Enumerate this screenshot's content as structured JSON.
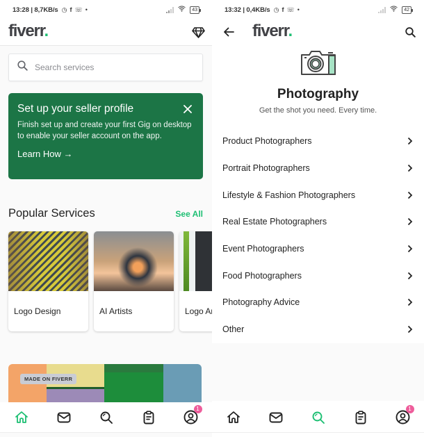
{
  "left_screen": {
    "status_bar": {
      "time_speed": "13:28 | 8,7KB/s",
      "battery": "43"
    },
    "header": {
      "logo_text": "fiverr",
      "logo_dot": ".",
      "right_icon": "diamond-icon"
    },
    "search": {
      "placeholder": "Search services"
    },
    "promo_card": {
      "title": "Set up your seller profile",
      "body": "Finish set up and create your first Gig on desktop to enable your seller account on the app.",
      "link": "Learn How →"
    },
    "popular_services": {
      "title": "Popular Services",
      "see_all": "See All",
      "items": [
        {
          "label": "Logo Design"
        },
        {
          "label": "AI Artists"
        },
        {
          "label": "Logo Animation"
        }
      ]
    },
    "banner": {
      "tag": "MADE ON FIVERR"
    },
    "tabbar": {
      "active": "home",
      "badge_count": "1"
    }
  },
  "right_screen": {
    "status_bar": {
      "time_speed": "13:32 | 0,4KB/s",
      "battery": "42"
    },
    "header": {
      "logo_text": "fiverr",
      "logo_dot": "."
    },
    "category": {
      "icon": "camera-icon",
      "title": "Photography",
      "subtitle": "Get the shot you need. Every time.",
      "subcategories": [
        {
          "label": "Product Photographers"
        },
        {
          "label": "Portrait Photographers"
        },
        {
          "label": "Lifestyle & Fashion Photographers"
        },
        {
          "label": "Real Estate Photographers"
        },
        {
          "label": "Event Photographers"
        },
        {
          "label": "Food Photographers"
        },
        {
          "label": "Photography Advice"
        },
        {
          "label": "Other"
        }
      ]
    },
    "tabbar": {
      "active": "search",
      "badge_count": "1"
    }
  },
  "colors": {
    "brand_green": "#1dbf73",
    "promo_green": "#1c7546",
    "badge_pink": "#ee5d9b",
    "text_dark": "#222325"
  }
}
